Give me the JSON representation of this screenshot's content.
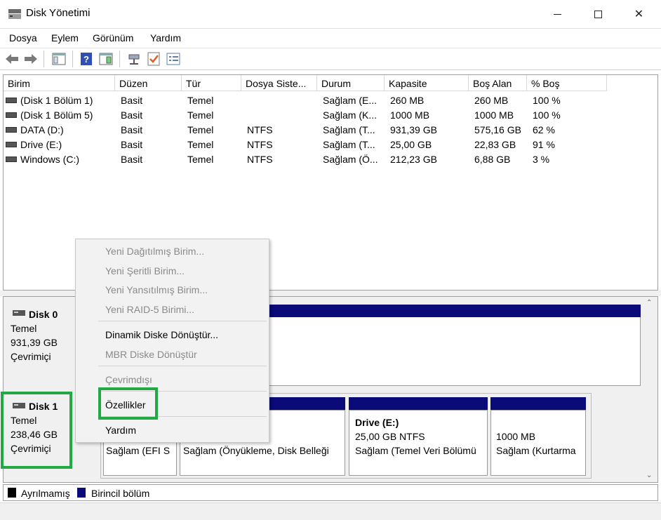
{
  "window": {
    "title": "Disk Yönetimi",
    "minimize": "—",
    "maximize": "☐",
    "close": "✕"
  },
  "menubar": [
    "Dosya",
    "Eylem",
    "Görünüm",
    "Yardım"
  ],
  "toolbar": {
    "icons": [
      "back-arrow-icon",
      "forward-arrow-icon",
      "console-tree-icon",
      "help-icon",
      "show-pane-icon",
      "connect-icon",
      "check-icon",
      "list-icon"
    ]
  },
  "volumes": {
    "columns": [
      "Birim",
      "Düzen",
      "Tür",
      "Dosya Siste...",
      "Durum",
      "Kapasite",
      "Boş Alan",
      "% Boş"
    ],
    "rows": [
      [
        "(Disk 1 Bölüm 1)",
        "Basit",
        "Temel",
        "",
        "Sağlam (E...",
        "260 MB",
        "260 MB",
        "100 %"
      ],
      [
        "(Disk 1 Bölüm 5)",
        "Basit",
        "Temel",
        "",
        "Sağlam (K...",
        "1000 MB",
        "1000 MB",
        "100 %"
      ],
      [
        "DATA (D:)",
        "Basit",
        "Temel",
        "NTFS",
        "Sağlam (T...",
        "931,39 GB",
        "575,16 GB",
        "62 %"
      ],
      [
        "Drive (E:)",
        "Basit",
        "Temel",
        "NTFS",
        "Sağlam (T...",
        "25,00 GB",
        "22,83 GB",
        "91 %"
      ],
      [
        "Windows (C:)",
        "Basit",
        "Temel",
        "NTFS",
        "Sağlam (Ö...",
        "212,23 GB",
        "6,88 GB",
        "3 %"
      ]
    ]
  },
  "disks": {
    "disk0": {
      "name": "Disk 0",
      "type": "Temel",
      "size": "931,39 GB",
      "status": "Çevrimiçi"
    },
    "disk1": {
      "name": "Disk 1",
      "type": "Temel",
      "size": "238,46 GB",
      "status": "Çevrimiçi",
      "parts": {
        "p1": {
          "status": "Sağlam (EFI S"
        },
        "p2": {
          "status": "Sağlam (Önyükleme, Disk Belleği"
        },
        "p3": {
          "name": "Drive  (E:)",
          "size": "25,00 GB NTFS",
          "status": "Sağlam (Temel Veri Bölümü"
        },
        "p4": {
          "size": "1000 MB",
          "status": "Sağlam (Kurtarma"
        }
      }
    }
  },
  "legend": {
    "unallocated": "Ayrılmamış",
    "primary": "Birincil bölüm",
    "unallocated_color": "#000000",
    "primary_color": "#0a0a78"
  },
  "context_menu": {
    "items": [
      "Yeni Dağıtılmış Birim...",
      "Yeni Şeritli Birim...",
      "Yeni Yansıtılmış Birim...",
      "Yeni RAID-5 Birimi...",
      "Dinamik Diske Dönüştür...",
      "MBR Diske Dönüştür",
      "Çevrimdışı",
      "Özellikler",
      "Yardım"
    ]
  },
  "colors": {
    "highlight": "#22a844",
    "bar": "#0a0a78"
  }
}
